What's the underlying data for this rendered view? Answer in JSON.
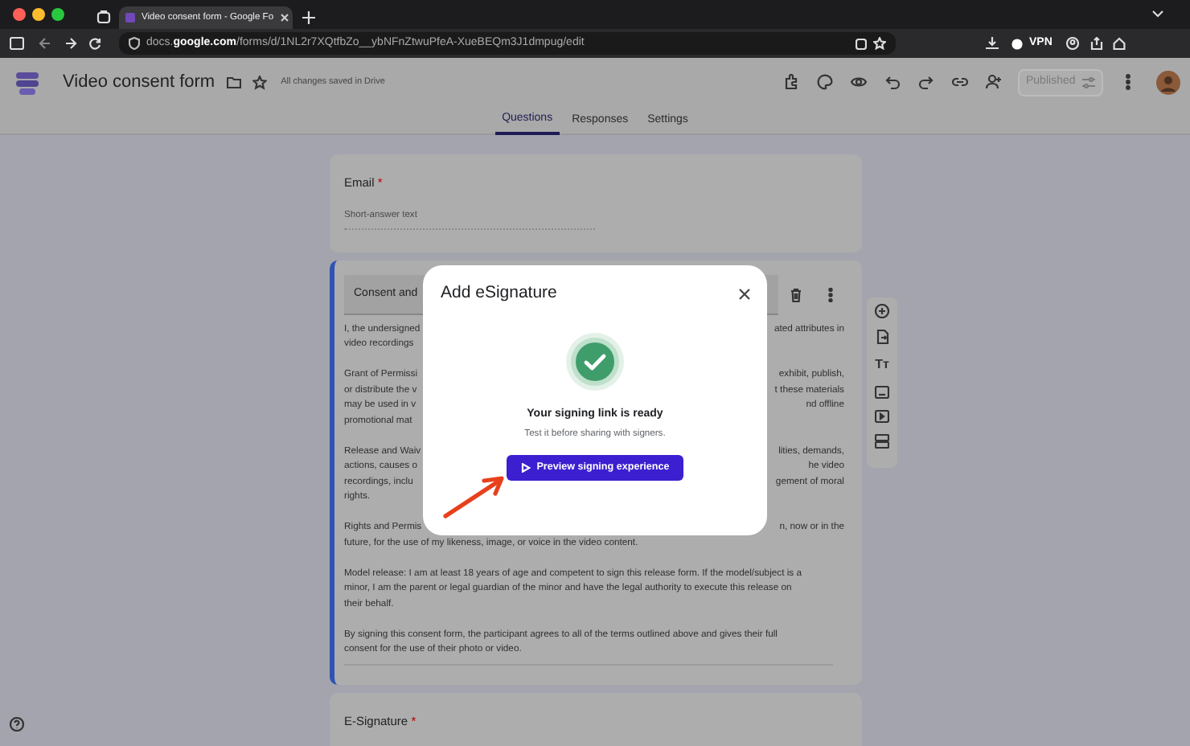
{
  "browser": {
    "tab_title": "Video consent form - Google Fo",
    "url": "docs.**google.com**/forms/d/1NL2r7XQtfbZo__ybNFnZtwuPfeA-XueBEQm3J1dmpug/edit",
    "vpn": "VPN"
  },
  "header": {
    "title": "Video consent form",
    "save_status": "All changes saved in Drive",
    "publish_button": "Published"
  },
  "tabs": [
    {
      "label": "Questions",
      "selected": true
    },
    {
      "label": "Responses",
      "selected": false
    },
    {
      "label": "Settings",
      "selected": false
    }
  ],
  "questions": [
    {
      "kind": "short",
      "title": "Email",
      "required_mark": "*",
      "placeholder": "Short-answer text",
      "selected": false
    },
    {
      "kind": "text",
      "title": "Consent and",
      "selected": true,
      "paragraphs": [
        [
          {
            "left": "I, the undersigned",
            "right": "ated attributes in"
          },
          {
            "left": "video recordings"
          }
        ],
        [
          {
            "left": "Grant of Permissi",
            "right": "exhibit, publish,"
          },
          {
            "left": "or distribute the v",
            "right": "t these materials"
          },
          {
            "left": "may be used in v",
            "right": "nd offline"
          },
          {
            "left": "promotional mat"
          }
        ],
        [
          {
            "left": "Release and Waiv",
            "right": "lities, demands,"
          },
          {
            "left": "actions, causes o",
            "right": "he video"
          },
          {
            "left": "recordings, inclu",
            "right": "gement of moral"
          },
          {
            "text": "rights."
          }
        ],
        [
          {
            "left": "Rights and Permis",
            "right": "n, now or in the"
          },
          {
            "text": "future, for the use of my likeness, image, or voice in the video content."
          }
        ],
        [
          {
            "text": "Model release: I am at least 18 years of age and competent to sign this release form. If the model/subject is a"
          },
          {
            "text": "minor, I am the parent or legal guardian of the minor and have the legal authority to execute this release on"
          },
          {
            "text": "their behalf."
          }
        ],
        [
          {
            "text": "By signing this consent form, the participant agrees to all of the terms outlined above and gives their full"
          },
          {
            "text": "consent for the use of their photo or video."
          }
        ]
      ]
    },
    {
      "kind": "esign",
      "title": "E-Signature",
      "required_mark": "*",
      "selected": false
    }
  ],
  "side_toolbar": {
    "text_tool": "Tт"
  },
  "dialog": {
    "title": "Add eSignature",
    "heading": "Your signing link is ready",
    "subtext": "Test it before sharing with signers.",
    "button": "Preview signing experience"
  }
}
